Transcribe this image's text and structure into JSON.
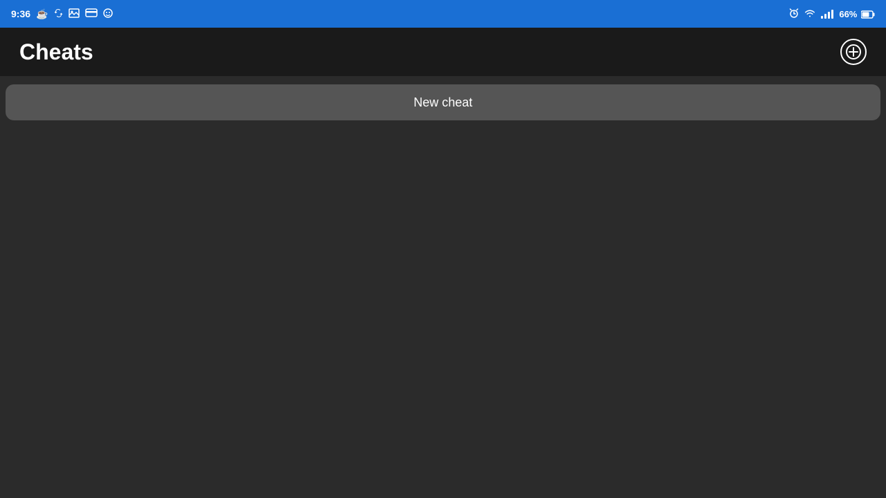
{
  "status_bar": {
    "time": "9:36",
    "battery_percent": "66%",
    "icons_left": [
      "clock-alarm-icon",
      "sync-icon",
      "image-icon",
      "card-icon",
      "face-icon"
    ],
    "icons_right": [
      "alarm-icon",
      "wifi-icon",
      "signal-icon",
      "battery-icon"
    ]
  },
  "header": {
    "title": "Cheats",
    "add_button_label": "+"
  },
  "content": {
    "new_cheat_button_label": "New cheat"
  }
}
